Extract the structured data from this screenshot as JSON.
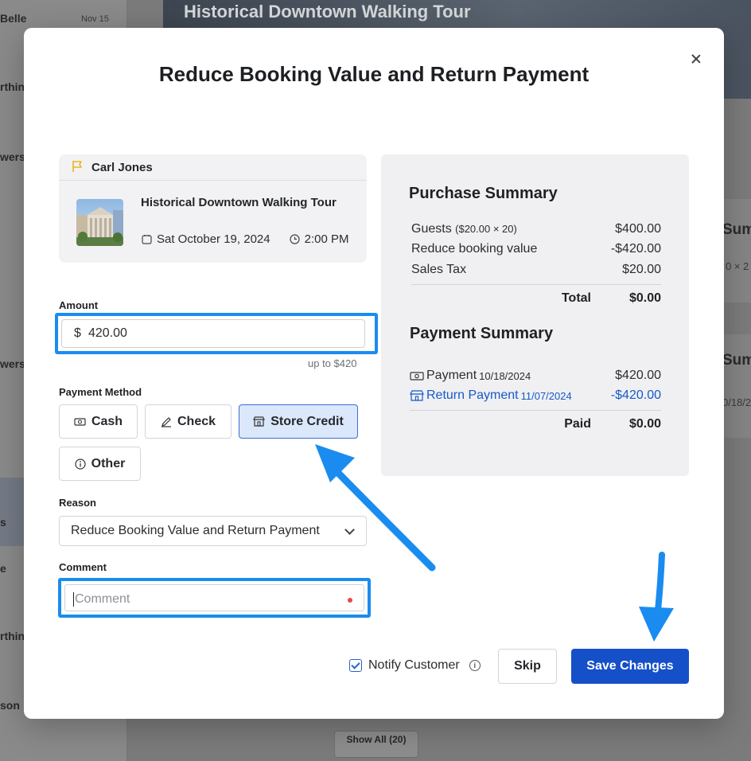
{
  "background": {
    "hero_title": "Historical Downtown Walking Tour",
    "sidebar_fragments": [
      "Belle",
      "rthin",
      "wers",
      "wers",
      "s",
      "e",
      "rthin",
      "son"
    ],
    "sidebar_date": "Nov 15",
    "card_fragments": [
      "Sum",
      "0 × 2",
      "Sum",
      "0/18/2"
    ],
    "show_all": "Show All (20)"
  },
  "modal": {
    "title": "Reduce Booking Value and Return Payment"
  },
  "booking": {
    "customer_name": "Carl Jones",
    "tour_name": "Historical Downtown Walking Tour",
    "date": "Sat October 19, 2024",
    "time": "2:00 PM"
  },
  "amount": {
    "label": "Amount",
    "prefix": "$",
    "value": "420.00",
    "hint": "up to $420"
  },
  "payment_method": {
    "label": "Payment Method",
    "options": [
      "Cash",
      "Check",
      "Store Credit",
      "Other"
    ],
    "selected": "Store Credit"
  },
  "reason": {
    "label": "Reason",
    "value": "Reduce Booking Value and Return Payment"
  },
  "comment": {
    "label": "Comment",
    "placeholder": "Comment"
  },
  "purchase_summary": {
    "title": "Purchase Summary",
    "rows": [
      {
        "label": "Guests",
        "detail": "($20.00 × 20)",
        "value": "$400.00"
      },
      {
        "label": "Reduce booking value",
        "detail": "",
        "value": "-$420.00"
      },
      {
        "label": "Sales Tax",
        "detail": "",
        "value": "$20.00"
      }
    ],
    "total_label": "Total",
    "total_value": "$0.00"
  },
  "payment_summary": {
    "title": "Payment Summary",
    "rows": [
      {
        "label": "Payment",
        "date": "10/18/2024",
        "value": "$420.00"
      },
      {
        "label": "Return Payment",
        "date": "11/07/2024",
        "value": "-$420.00"
      }
    ],
    "paid_label": "Paid",
    "paid_value": "$0.00"
  },
  "footer": {
    "notify_label": "Notify Customer",
    "notify_checked": true,
    "skip_label": "Skip",
    "save_label": "Save Changes"
  },
  "colors": {
    "accent": "#1650c8",
    "highlight_box": "#1a8cf0",
    "link": "#1559c9",
    "selected_bg": "#dbe7fb"
  }
}
